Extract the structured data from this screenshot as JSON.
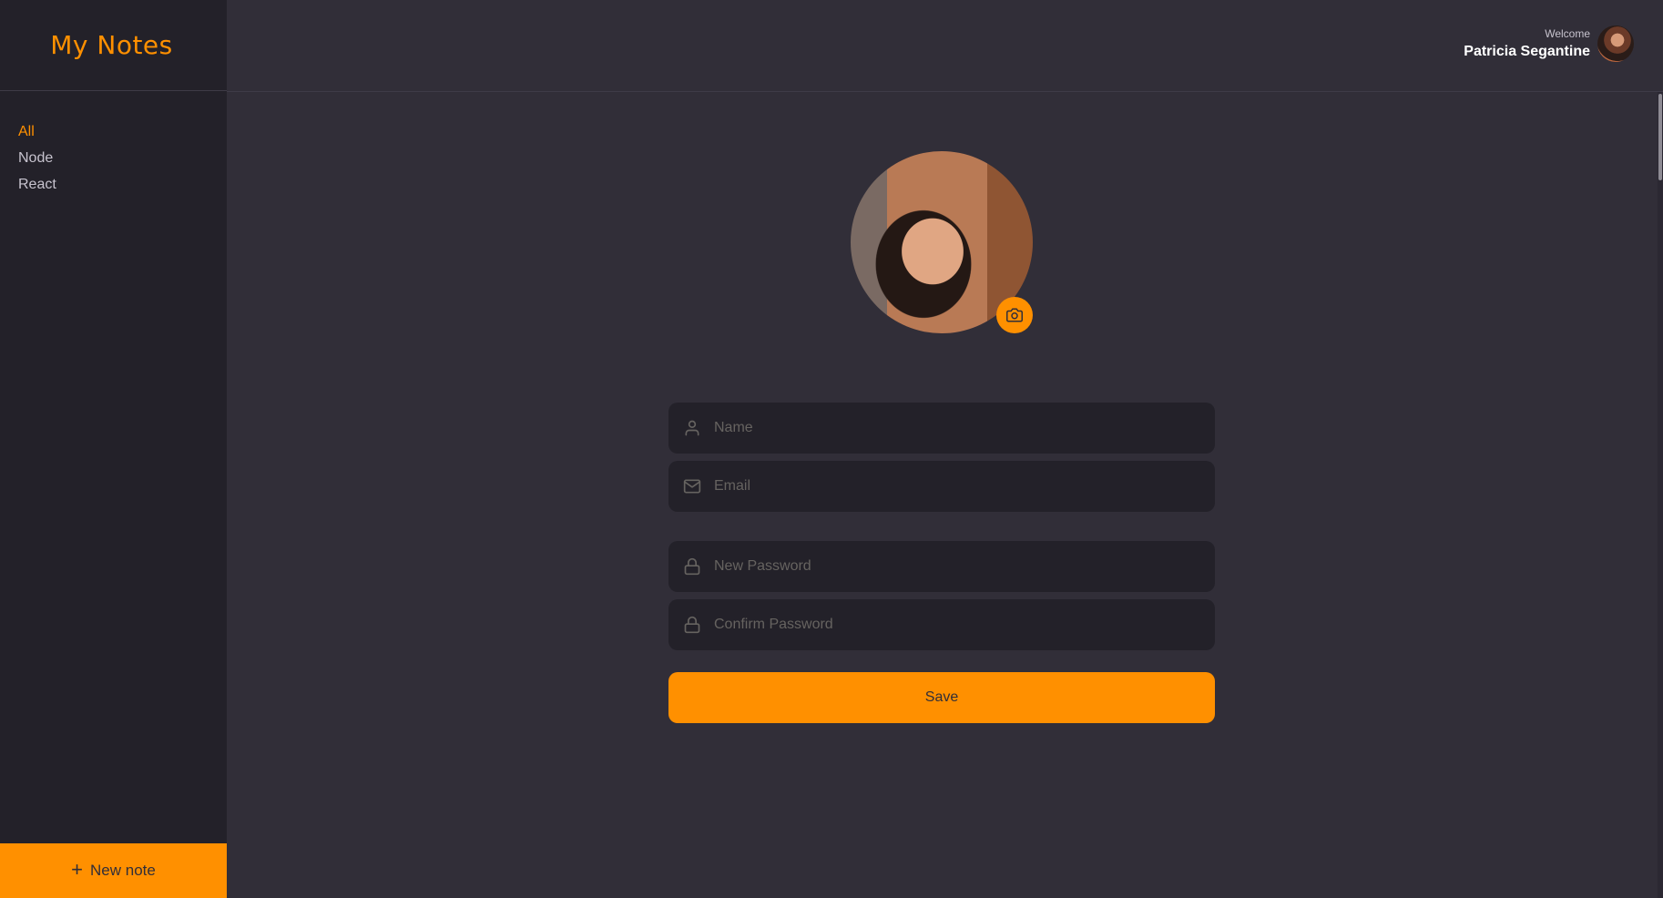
{
  "sidebar": {
    "brand": "My Notes",
    "menu": [
      {
        "label": "All",
        "active": true
      },
      {
        "label": "Node",
        "active": false
      },
      {
        "label": "React",
        "active": false
      }
    ],
    "new_note_label": "New note",
    "new_note_icon": "plus-icon"
  },
  "header": {
    "welcome": "Welcome",
    "user_name": "Patricia Segantine"
  },
  "profile_form": {
    "avatar_button_icon": "camera-icon",
    "fields": {
      "name": {
        "placeholder": "Name",
        "icon": "user-icon"
      },
      "email": {
        "placeholder": "Email",
        "icon": "mail-icon"
      },
      "new_password": {
        "placeholder": "New Password",
        "icon": "lock-icon"
      },
      "confirm_password": {
        "placeholder": "Confirm Password",
        "icon": "lock-icon"
      }
    },
    "save_label": "Save"
  },
  "colors": {
    "accent": "#ff9000",
    "background": "#312e38",
    "sidebar": "#232129",
    "input_bg": "#232129",
    "placeholder": "#666360"
  }
}
